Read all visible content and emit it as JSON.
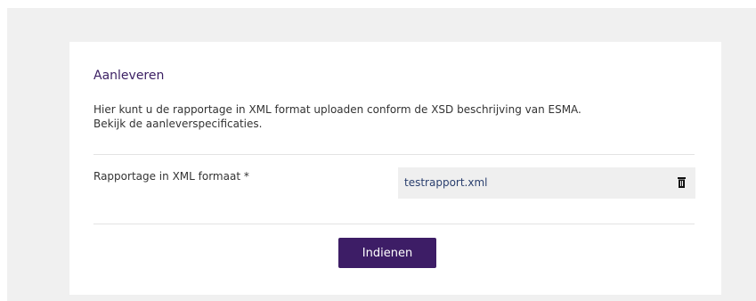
{
  "form": {
    "title": "Aanleveren",
    "description_line1": "Hier kunt u de rapportage in XML format uploaden conform de XSD beschrijving van ESMA.",
    "description_line2": "Bekijk de aanleverspecificaties.",
    "field_label": "Rapportage in XML formaat *",
    "file_name": "testrapport.xml",
    "delete_icon": "trash-icon",
    "submit_label": "Indienen"
  },
  "colors": {
    "accent": "#3d1d66",
    "title": "#3b1f63",
    "file_text": "#2a3f6e",
    "background": "#f0f0f0"
  }
}
